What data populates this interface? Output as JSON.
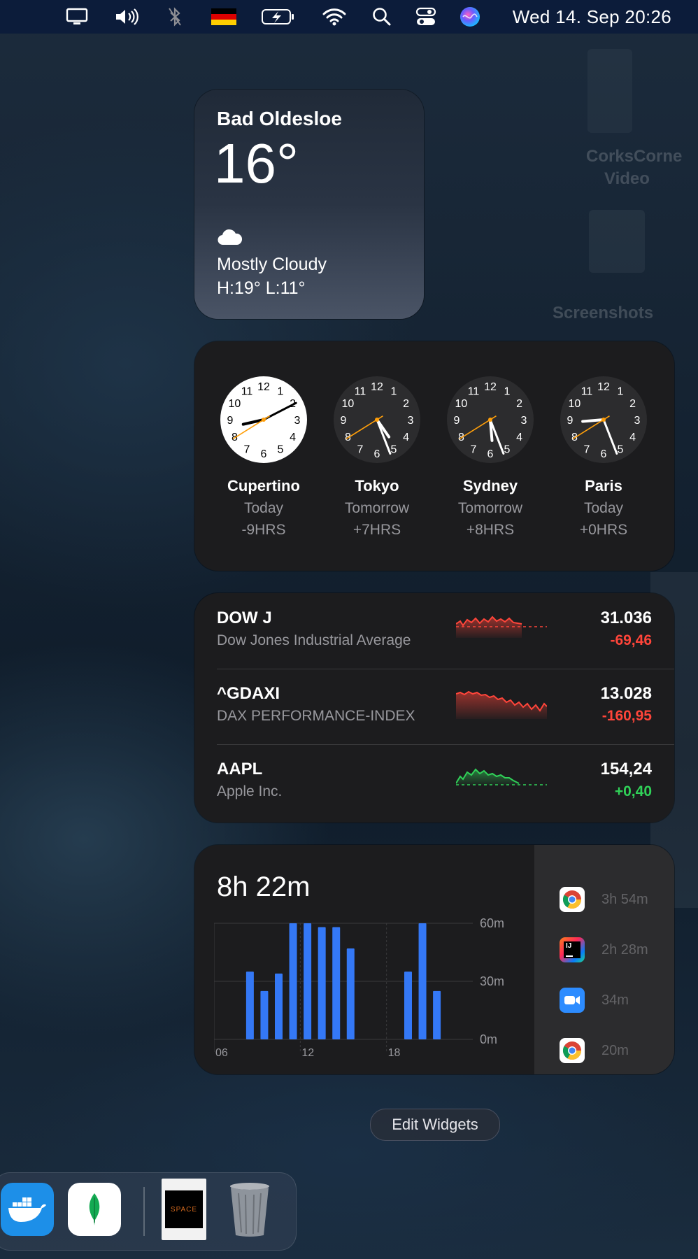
{
  "menubar": {
    "icons": [
      "display-icon",
      "volume-icon",
      "bluetooth-icon",
      "german-flag-icon",
      "battery-charging-icon",
      "wifi-icon",
      "search-icon",
      "control-center-icon",
      "siri-icon"
    ],
    "clock": "Wed 14. Sep  20:26"
  },
  "desktop_ghosts": {
    "item1": "CorksCorne",
    "item1b": "Video",
    "item2": "Screenshots"
  },
  "weather": {
    "city": "Bad Oldesloe",
    "temp": "16°",
    "condition": "Mostly Cloudy",
    "high_low": "H:19° L:11°",
    "icon": "cloud-icon"
  },
  "world_clock": {
    "clocks": [
      {
        "city": "Cupertino",
        "day": "Today",
        "offset": "-9HRS",
        "face": "light"
      },
      {
        "city": "Tokyo",
        "day": "Tomorrow",
        "offset": "+7HRS",
        "face": "dark"
      },
      {
        "city": "Sydney",
        "day": "Tomorrow",
        "offset": "+8HRS",
        "face": "dark"
      },
      {
        "city": "Paris",
        "day": "Today",
        "offset": "+0HRS",
        "face": "dark"
      }
    ],
    "numerals": [
      "12",
      "1",
      "2",
      "3",
      "4",
      "5",
      "6",
      "7",
      "8",
      "9",
      "10",
      "11"
    ]
  },
  "stocks": {
    "rows": [
      {
        "symbol": "DOW J",
        "name": "Dow Jones Industrial Average",
        "price": "31.036",
        "change": "-69,46",
        "trend": "down"
      },
      {
        "symbol": "^GDAXI",
        "name": "DAX PERFORMANCE-INDEX",
        "price": "13.028",
        "change": "-160,95",
        "trend": "down"
      },
      {
        "symbol": "AAPL",
        "name": "Apple Inc.",
        "price": "154,24",
        "change": "+0,40",
        "trend": "up"
      }
    ],
    "colors": {
      "down": "#ff453a",
      "up": "#30d158"
    }
  },
  "screen_time": {
    "total": "8h 22m",
    "y_labels": [
      "60m",
      "30m",
      "0m"
    ],
    "x_labels": [
      "06",
      "12",
      "18"
    ],
    "apps": [
      {
        "icon": "chrome-icon",
        "time": "3h 54m"
      },
      {
        "icon": "intellij-icon",
        "time": "2h 28m"
      },
      {
        "icon": "zoom-icon",
        "time": "34m"
      },
      {
        "icon": "chrome-icon",
        "time": "20m"
      }
    ],
    "bar_color": "#3478f6"
  },
  "chart_data": {
    "type": "bar",
    "title": "",
    "xlabel": "",
    "ylabel": "",
    "ylim": [
      0,
      60
    ],
    "x_ticks": [
      "06",
      "12",
      "18"
    ],
    "hours": [
      6,
      7,
      8,
      9,
      10,
      11,
      12,
      13,
      14,
      15,
      16,
      17,
      18,
      19,
      20,
      21,
      22,
      23
    ],
    "values": [
      0,
      0,
      35,
      25,
      34,
      60,
      60,
      58,
      58,
      47,
      0,
      0,
      0,
      35,
      60,
      25,
      0,
      0
    ]
  },
  "edit_widgets": "Edit Widgets",
  "dock": {
    "items": [
      {
        "icon": "docker-icon"
      },
      {
        "icon": "mongodb-icon"
      },
      {
        "icon": "space-document-icon"
      },
      {
        "icon": "trash-icon"
      }
    ],
    "space_label": "SPACE"
  }
}
